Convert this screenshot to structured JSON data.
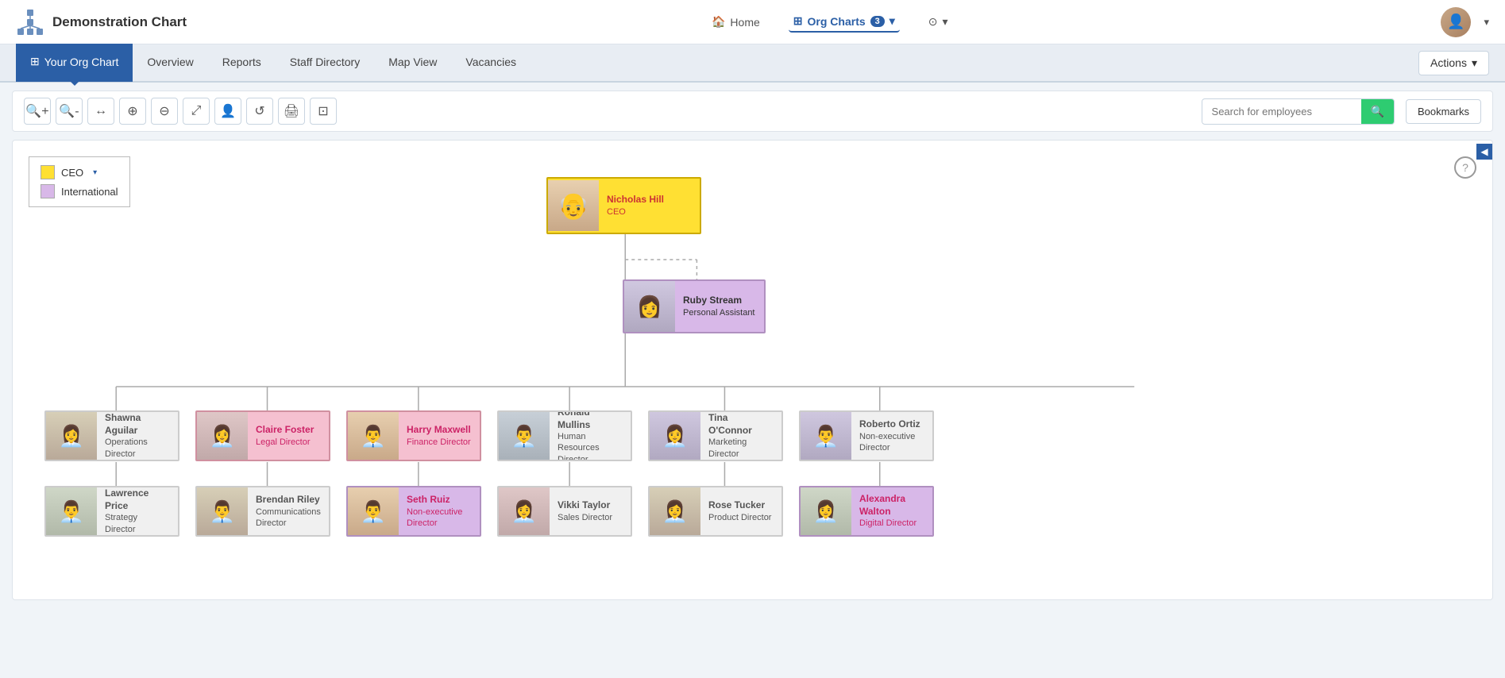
{
  "app": {
    "title": "Demonstration Chart",
    "logo_icon": "org-chart-icon"
  },
  "top_nav": {
    "home_label": "Home",
    "org_charts_label": "Org Charts",
    "org_charts_count": "3",
    "help_icon": "help-icon",
    "dropdown_icon": "chevron-down-icon",
    "user_avatar_alt": "User avatar"
  },
  "sub_nav": {
    "tabs": [
      {
        "id": "your-org-chart",
        "label": "Your Org Chart",
        "active": true,
        "icon": "table-icon"
      },
      {
        "id": "overview",
        "label": "Overview",
        "active": false
      },
      {
        "id": "reports",
        "label": "Reports",
        "active": false
      },
      {
        "id": "staff-directory",
        "label": "Staff Directory",
        "active": false
      },
      {
        "id": "map-view",
        "label": "Map View",
        "active": false
      },
      {
        "id": "vacancies",
        "label": "Vacancies",
        "active": false
      }
    ],
    "actions_label": "Actions"
  },
  "toolbar": {
    "zoom_in": "zoom-in",
    "zoom_out": "zoom-out",
    "fit": "fit",
    "expand": "expand",
    "collapse": "collapse",
    "diagonal": "diagonal",
    "person": "person",
    "refresh": "refresh",
    "print": "print",
    "export": "export",
    "search_placeholder": "Search for employees",
    "search_icon": "search-icon",
    "bookmarks_label": "Bookmarks"
  },
  "legend": {
    "items": [
      {
        "id": "ceo",
        "label": "CEO",
        "color": "#ffe033",
        "has_dropdown": true
      },
      {
        "id": "international",
        "label": "International",
        "color": "#d8b8e8",
        "has_dropdown": false
      }
    ]
  },
  "org_chart": {
    "nodes": [
      {
        "id": "nicholas-hill",
        "name": "Nicholas Hill",
        "title": "CEO",
        "type": "ceo",
        "avatar_style": "avatar-1"
      },
      {
        "id": "ruby-stream",
        "name": "Ruby Stream",
        "title": "Personal Assistant",
        "type": "pa",
        "avatar_style": "avatar-2"
      },
      {
        "id": "shawna-aguilar",
        "name": "Shawna Aguilar",
        "title": "Operations Director",
        "type": "director",
        "avatar_style": "avatar-3"
      },
      {
        "id": "claire-foster",
        "name": "Claire Foster",
        "title": "Legal Director",
        "type": "director-highlight",
        "avatar_style": "avatar-5"
      },
      {
        "id": "harry-maxwell",
        "name": "Harry Maxwell",
        "title": "Finance Director",
        "type": "director-highlight",
        "avatar_style": "avatar-1"
      },
      {
        "id": "ronald-mullins",
        "name": "Ronald Mullins",
        "title": "Human Resources Director",
        "type": "director",
        "avatar_style": "avatar-4"
      },
      {
        "id": "tina-oconnor",
        "name": "Tina O'Connor",
        "title": "Marketing Director",
        "type": "director",
        "avatar_style": "avatar-2"
      },
      {
        "id": "roberto-ortiz",
        "name": "Roberto Ortiz",
        "title": "Non-executive Director",
        "type": "director",
        "avatar_style": "avatar-2"
      },
      {
        "id": "lawrence-price",
        "name": "Lawrence Price",
        "title": "Strategy Director",
        "type": "sub",
        "avatar_style": "avatar-6"
      },
      {
        "id": "brendan-riley",
        "name": "Brendan Riley",
        "title": "Communications Director",
        "type": "sub",
        "avatar_style": "avatar-3"
      },
      {
        "id": "seth-ruiz",
        "name": "Seth Ruiz",
        "title": "Non-executive Director",
        "type": "sub-highlight",
        "avatar_style": "avatar-1"
      },
      {
        "id": "vikki-taylor",
        "name": "Vikki Taylor",
        "title": "Sales Director",
        "type": "sub",
        "avatar_style": "avatar-5"
      },
      {
        "id": "rose-tucker",
        "name": "Rose Tucker",
        "title": "Product Director",
        "type": "sub",
        "avatar_style": "avatar-3"
      },
      {
        "id": "alexandra-walton",
        "name": "Alexandra Walton",
        "title": "Digital Director",
        "type": "sub-highlight",
        "avatar_style": "avatar-6"
      }
    ]
  },
  "help_label": "?",
  "corner_btn_icon": "collapse-icon"
}
